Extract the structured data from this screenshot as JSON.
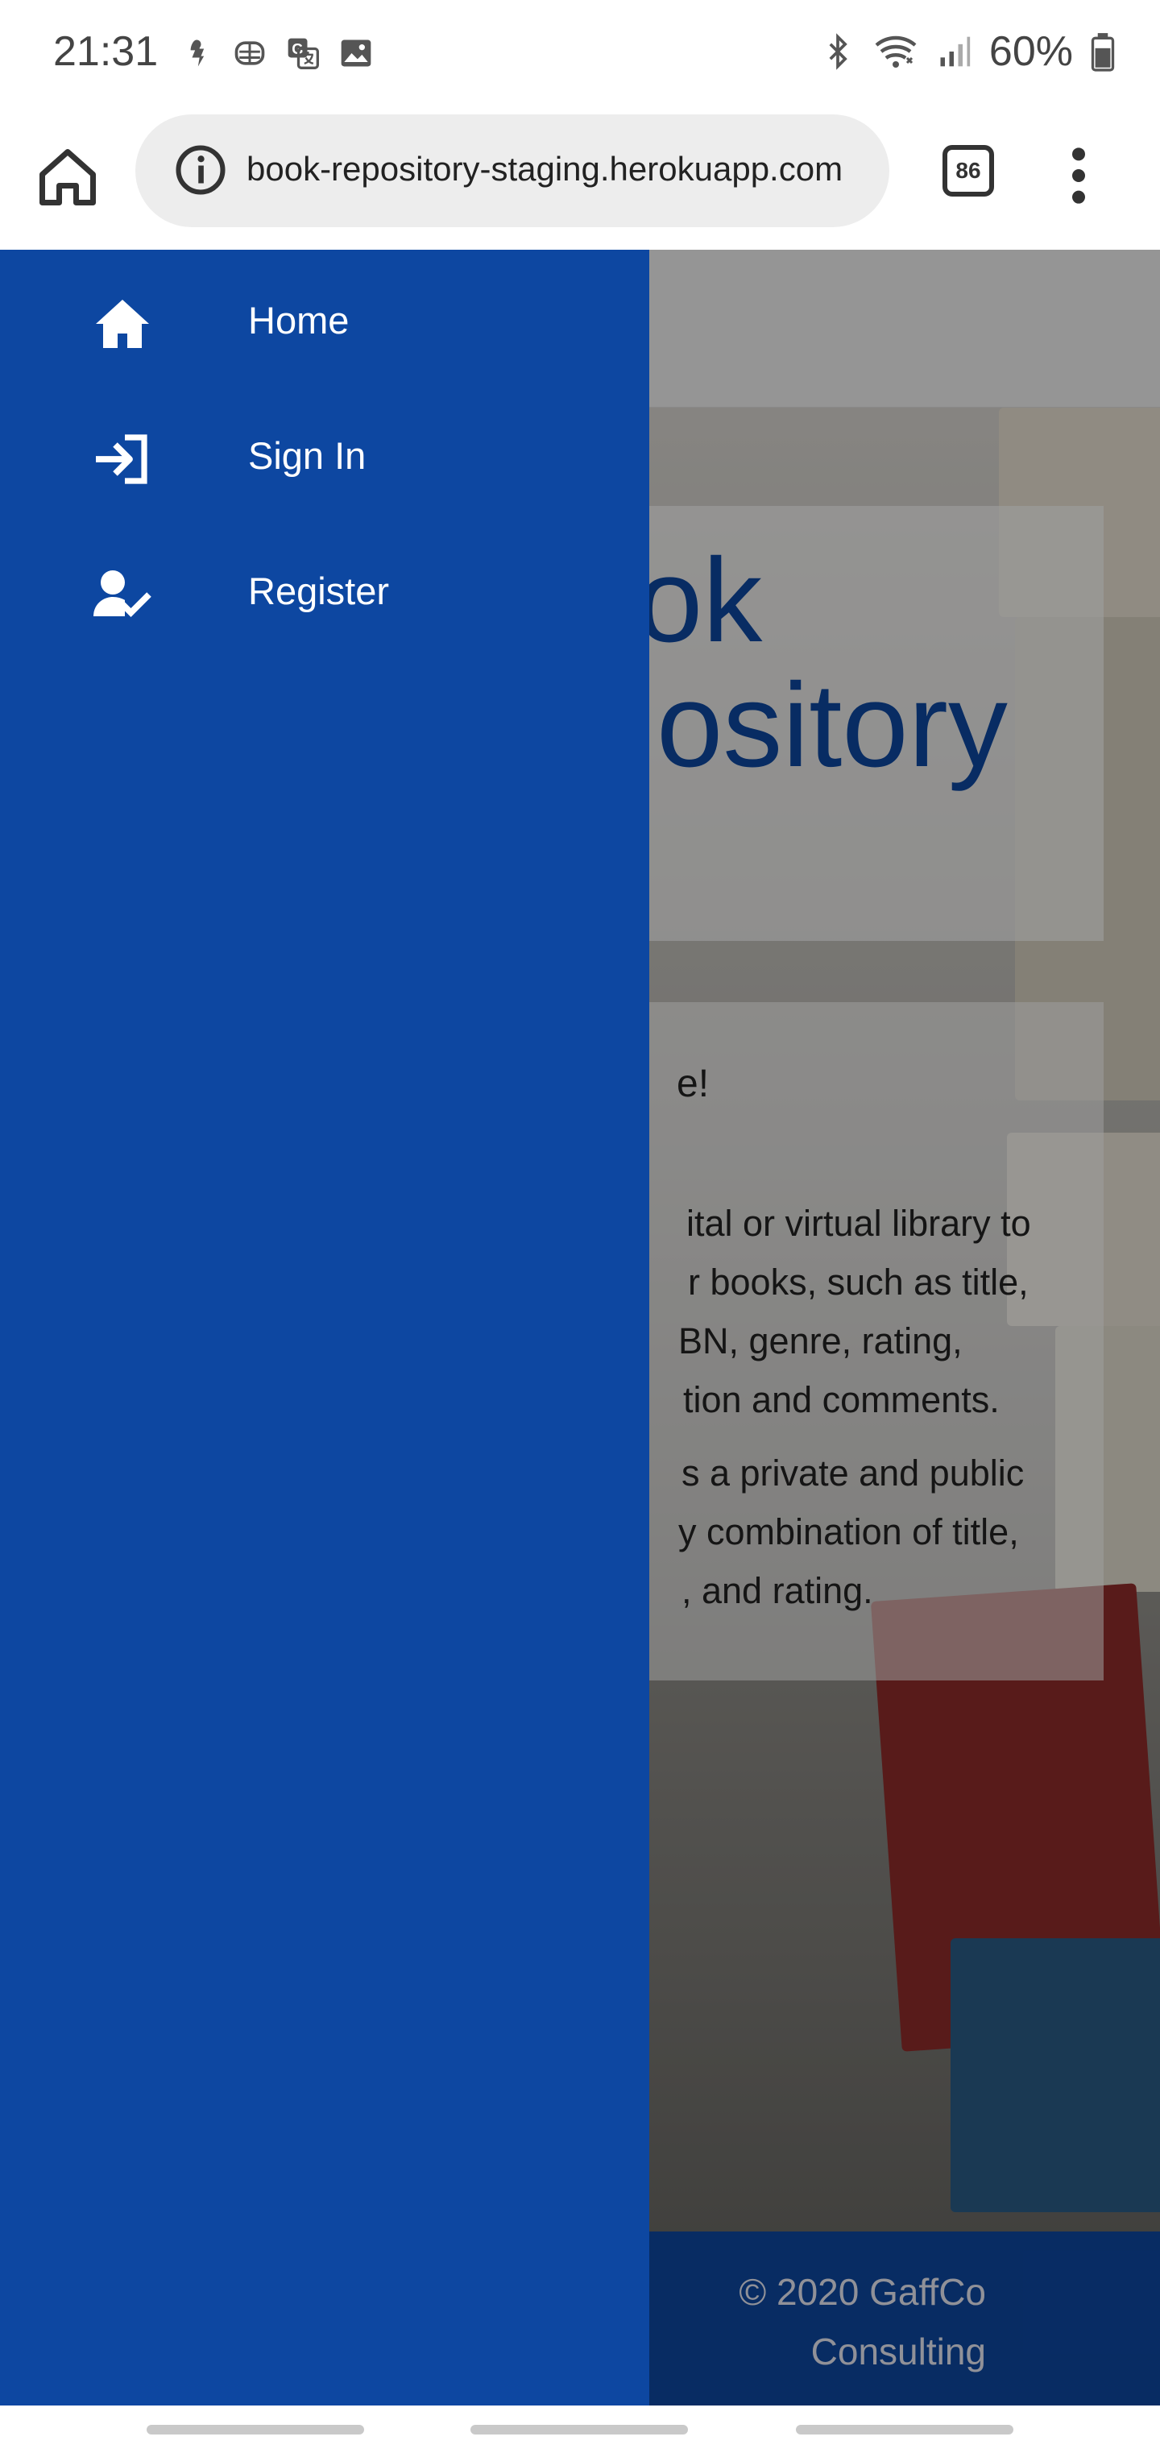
{
  "status_bar": {
    "time": "21:31",
    "battery": "60%",
    "left_icons": [
      "notification-icon",
      "app-notification-icon",
      "translate-icon",
      "image-icon"
    ],
    "right_icons": [
      "bluetooth-icon",
      "wifi-icon",
      "signal-icon",
      "battery-icon"
    ]
  },
  "browser": {
    "url": "book-repository-staging.herokuapp.com",
    "url_visible": "ok-repository-staging.herokuapp.com",
    "tab_count": "86"
  },
  "drawer": {
    "items": [
      {
        "label": "Home",
        "icon": "home-icon"
      },
      {
        "label": "Sign In",
        "icon": "sign-in-icon"
      },
      {
        "label": "Register",
        "icon": "register-icon"
      }
    ]
  },
  "page": {
    "title_line1": "ok",
    "title_line2": "ository",
    "welcome": "e!",
    "para1": [
      "ital or virtual library to",
      "r books, such as title,",
      "BN, genre, rating,",
      "tion and comments."
    ],
    "para2": [
      "s a private and public",
      "y combination of title,",
      ", and rating."
    ],
    "footer": "© 2020 GaffCo\nConsulting"
  },
  "colors": {
    "primary": "#0d47a1",
    "scrim": "rgba(0,0,0,0.38)"
  }
}
